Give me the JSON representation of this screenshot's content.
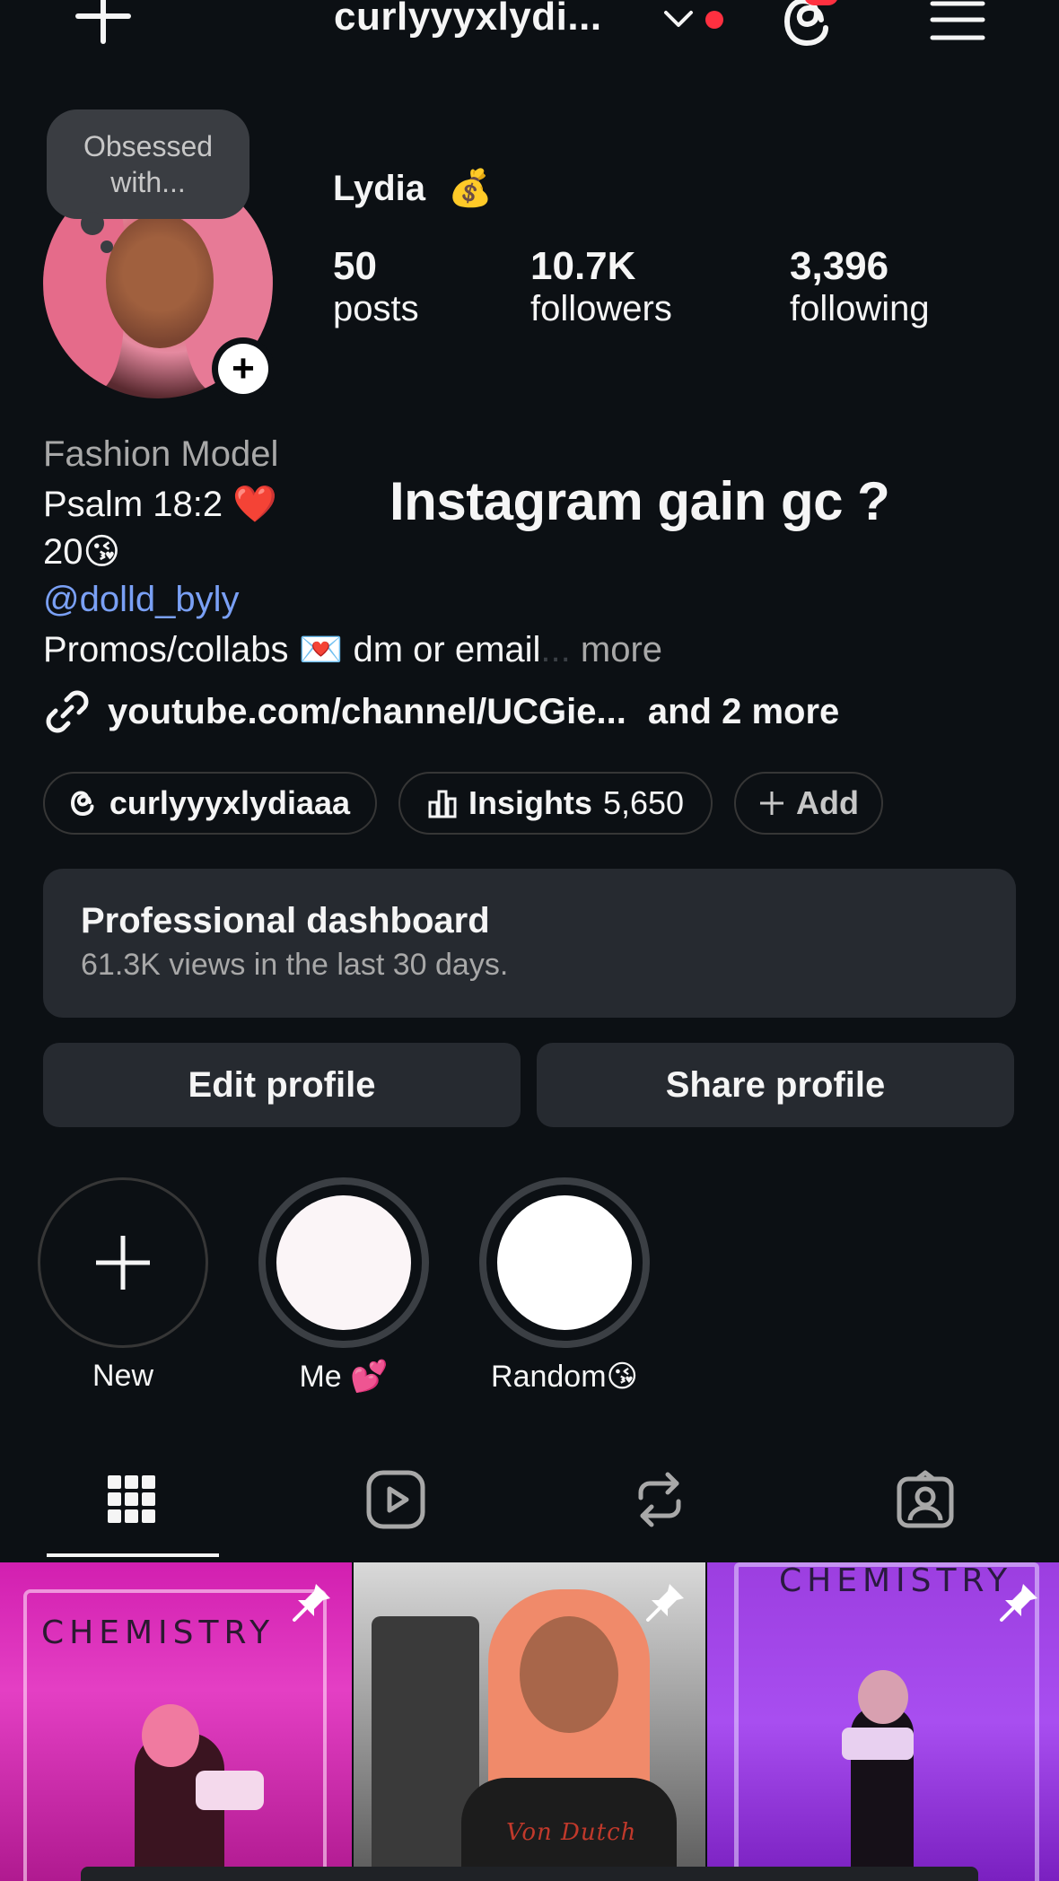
{
  "header": {
    "create_icon": "plus-icon",
    "username": "curlyyyxlydi...",
    "account_switch_icon": "chevron-down-icon",
    "threads_icon": "threads-icon",
    "menu_icon": "hamburger-menu-icon",
    "notification_color": "#ff3040"
  },
  "profile": {
    "note": [
      "Obsessed",
      "with..."
    ],
    "display_name": "Lydia",
    "name_emoji": "💰",
    "stats": [
      {
        "value": "50",
        "label": "posts"
      },
      {
        "value": "10.7K",
        "label": "followers"
      },
      {
        "value": "3,396",
        "label": "following"
      }
    ]
  },
  "bio": {
    "category": "Fashion Model",
    "line1": "Psalm 18:2 ❤️",
    "line2": "20😘",
    "mention": "@dolld_byly",
    "line3": "Promos/collabs 💌 dm or email",
    "ellipsis": "...",
    "more": "more",
    "link": "youtube.com/channel/UCGie...",
    "link_more": "and 2 more"
  },
  "overlay_text": "Instagram gain gc ?",
  "pills": {
    "threads_handle": "curlyyyxlydiaaa",
    "insights_label": "Insights",
    "insights_value": "5,650",
    "add_label": "Add"
  },
  "dashboard": {
    "title": "Professional dashboard",
    "subtitle": "61.3K views in the last 30 days."
  },
  "actions": {
    "edit": "Edit profile",
    "share": "Share profile"
  },
  "highlights": [
    {
      "label": "New"
    },
    {
      "label": "Me 💕"
    },
    {
      "label": "Random😘"
    }
  ],
  "tabs": [
    "grid-icon",
    "reels-icon",
    "reposts-icon",
    "tagged-icon"
  ],
  "posts": [
    {
      "caption": "CHEMISTRY",
      "pinned": true
    },
    {
      "caption": "Von Dutch",
      "pinned": true
    },
    {
      "caption": "CHEMISTRY",
      "pinned": true
    }
  ],
  "colors": {
    "background": "#0c1014",
    "button_bg": "#262a30",
    "link_blue": "#7aa0f5",
    "muted": "#a8a8a8"
  }
}
